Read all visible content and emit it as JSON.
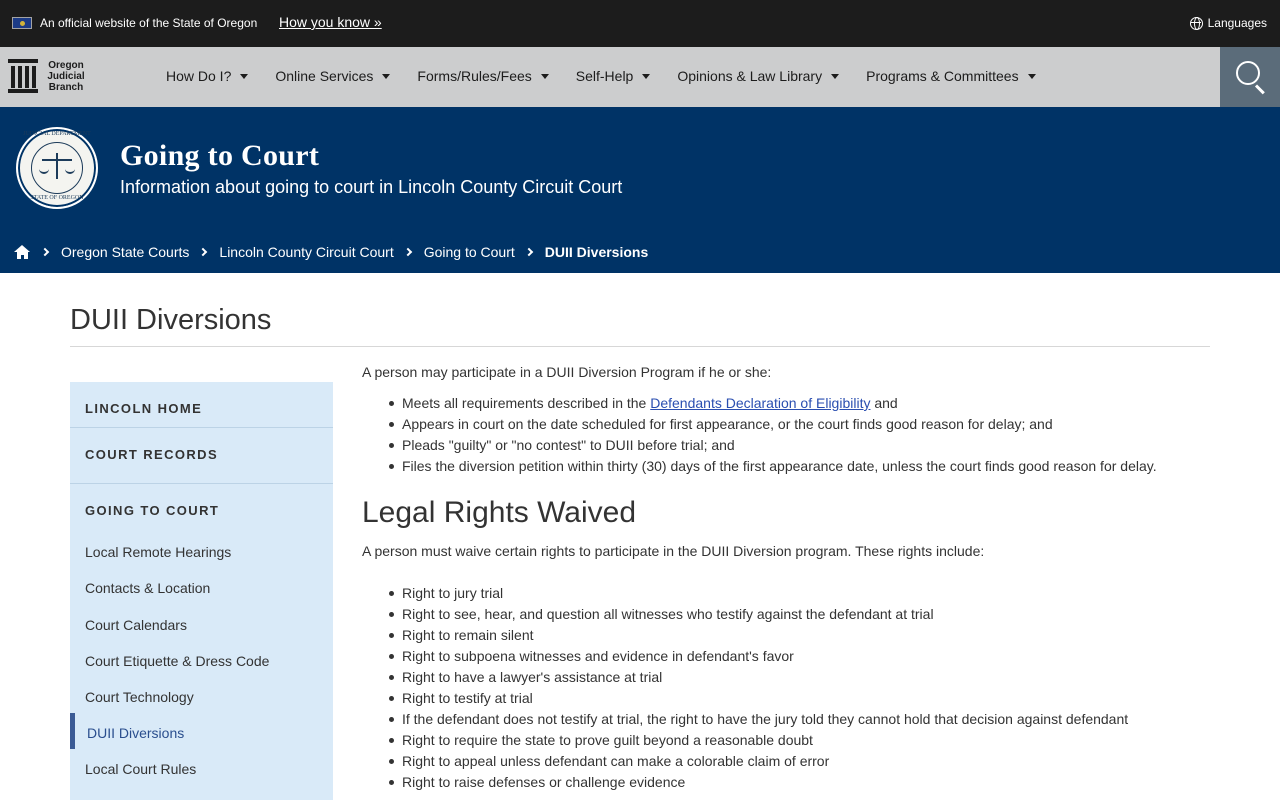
{
  "official_bar": {
    "text": "An official website of the State of Oregon",
    "how_link": "How you know »",
    "languages": "Languages"
  },
  "logo": {
    "line1": "Oregon",
    "line2": "Judicial",
    "line3": "Branch"
  },
  "nav": {
    "items": [
      {
        "label": "How Do I?"
      },
      {
        "label": "Online Services"
      },
      {
        "label": "Forms/Rules/Fees"
      },
      {
        "label": "Self-Help"
      },
      {
        "label": "Opinions & Law Library"
      },
      {
        "label": "Programs & Committees"
      }
    ]
  },
  "seal": {
    "top": "JUDICIAL DEPARTMENT",
    "bottom": "STATE OF OREGON"
  },
  "banner": {
    "title": "Going to Court",
    "subtitle": "Information about going to court in Lincoln County Circuit Court"
  },
  "breadcrumb": {
    "items": [
      "Oregon State Courts",
      "Lincoln County Circuit Court",
      "Going to Court"
    ],
    "current": "DUII Diversions"
  },
  "page": {
    "title": "DUII Diversions"
  },
  "sidebar": {
    "head_home": "LINCOLN HOME",
    "head_records": "COURT RECORDS",
    "head_going": "GOING TO COURT",
    "links": [
      "Local Remote Hearings",
      "Contacts & Location",
      "Court Calendars",
      "Court Etiquette & Dress Code",
      "Court Technology",
      "DUII Diversions",
      "Local Court Rules"
    ]
  },
  "content": {
    "intro": "A person may participate in a DUII Diversion Program if he or she:",
    "eligibility": {
      "item1_before": "Meets all requirements described in the ",
      "item1_link": "Defendants Declaration of Eligibility",
      "item1_after": " and",
      "item2": "Appears in court on the date scheduled for first appearance, or the court finds good reason for delay; and",
      "item3": "Pleads \"guilty\" or \"no contest\" to DUII before trial; and",
      "item4": "Files the diversion petition within thirty (30) days of the first appearance date, unless the court finds good reason for delay."
    },
    "rights_heading": "Legal Rights Waived",
    "rights_intro": "A person must waive certain rights to participate in the DUII Diversion program. These rights include:",
    "rights": [
      "Right to jury trial",
      "Right to see, hear, and question all witnesses who testify against the defendant at trial",
      "Right to remain silent",
      "Right to subpoena witnesses and evidence in defendant's favor",
      "Right to have a lawyer's assistance at trial",
      "Right to testify at trial",
      "If the defendant does not testify at trial, the right to have the jury told they cannot hold that decision against defendant",
      "Right to require the state to prove guilt beyond a reasonable doubt",
      "Right to appeal unless defendant can make a colorable claim of error",
      "Right to raise defenses or challenge evidence"
    ]
  },
  "colors": {
    "banner": "#003366",
    "nav": "#cccdce",
    "sidebar": "#d9eaf8",
    "topbar": "#1c1c1c"
  }
}
